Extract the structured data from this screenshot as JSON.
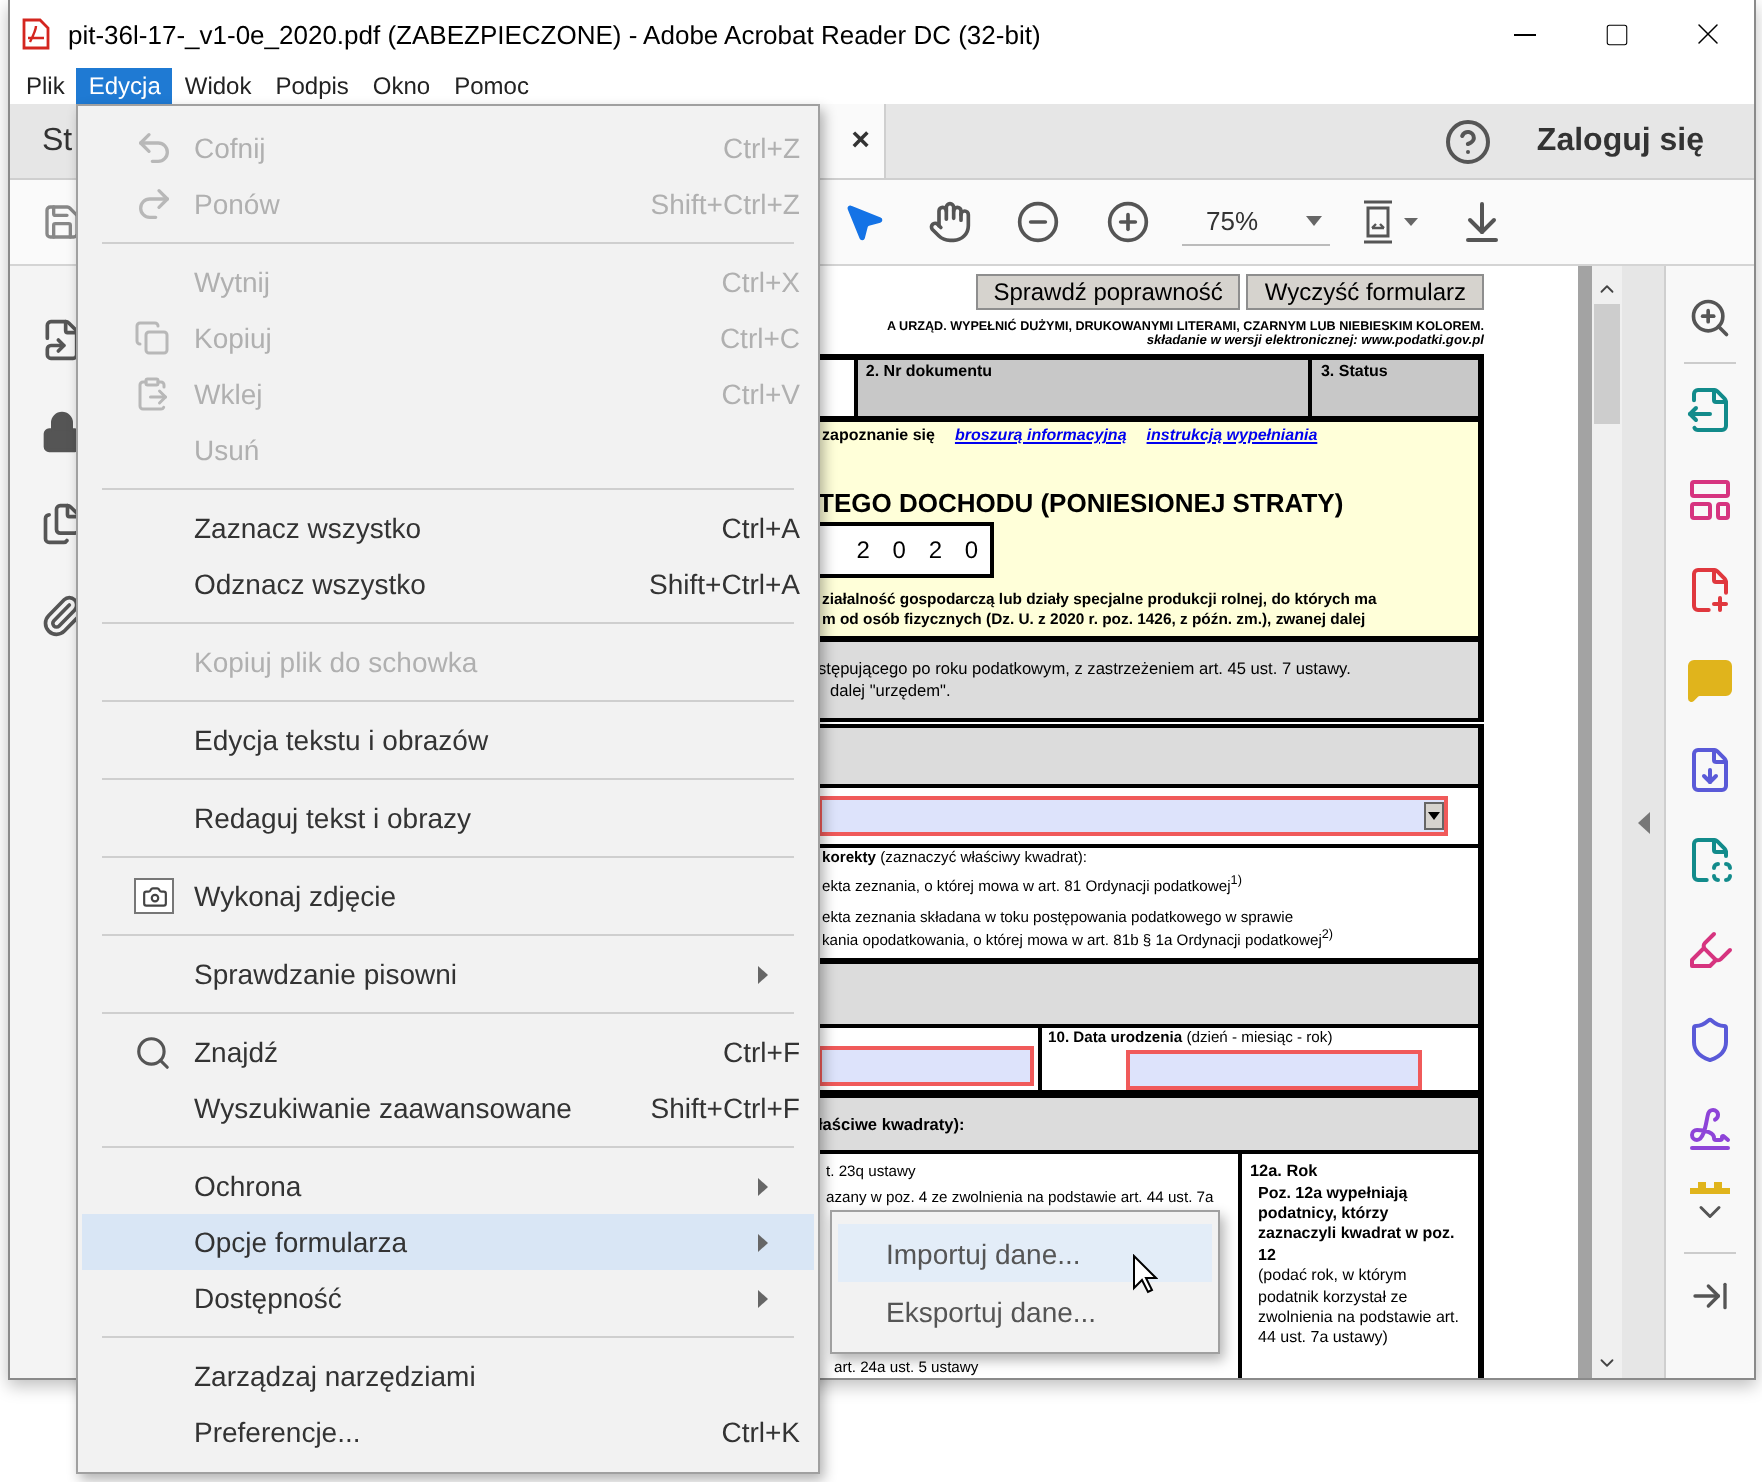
{
  "window": {
    "title": "pit-36l-17-_v1-0e_2020.pdf (ZABEZPIECZONE) - Adobe Acrobat Reader DC (32-bit)"
  },
  "menu_bar": [
    {
      "label": "Plik",
      "selected": false
    },
    {
      "label": "Edycja",
      "selected": true
    },
    {
      "label": "Widok",
      "selected": false
    },
    {
      "label": "Podpis",
      "selected": false
    },
    {
      "label": "Okno",
      "selected": false
    },
    {
      "label": "Pomoc",
      "selected": false
    }
  ],
  "tabs": [
    {
      "label": "St",
      "selected": false
    },
    {
      "close": "×",
      "selected": true
    }
  ],
  "sign_in": "Zaloguj się",
  "toolbar": {
    "zoom": "75%"
  },
  "form": {
    "buttons": [
      "Sprawdź poprawność",
      "Wyczyść formularz"
    ],
    "notice": "A URZĄD. WYPEŁNIĆ DUŻYMI, DRUKOWANYMI LITERAMI, CZARNYM LUB NIEBIESKIM KOLOREM.",
    "submission_note": "składanie w wersji elektronicznej: www.podatki.gov.pl",
    "header_fields": [
      "2. Nr dokumentu",
      "3. Status"
    ],
    "intro": "zapoznanie się",
    "links": [
      "broszurą informacyjną",
      "instrukcją wypełniania"
    ],
    "title": "TEGO DOCHODU (PONIESIONEJ STRATY)",
    "year": "2 0 2 0",
    "scope_lines": [
      "ziałalność gospodarczą lub działy specjalne produkcji rolnej, do których ma",
      "m od osób fizycznych (Dz. U. z 2020 r. poz. 1426, z późn. zm.), zwanej dalej"
    ],
    "office_lines": [
      "stępującego po roku podatkowym, z zastrzeżeniem art. 45 ust. 7 ustawy.",
      "dalej \"urzędem\"."
    ],
    "correction_lines": [
      "**korekty** (zaznaczyć właściwy kwadrat):",
      "ekta zeznania, o której mowa w art. 81 Ordynacji podatkowej$^{1)}$",
      "ekta zeznania składana w toku postępowania podatkowego w sprawie",
      "kania opodatkowania, o której mowa w art. 81b § 1a Ordynacji podatkowej$^{2)}$"
    ],
    "birth_date_label": "**10. Data urodzenia** (dzień - miesiąc - rok)",
    "section_label": "łaściwe kwadraty):",
    "left_lines": [
      "t. 23q ustawy",
      "azany w poz. 4 ze zwolnienia na podstawie art. 44 ust. 7a",
      "art. 24a ust. 5 ustawy"
    ],
    "year_field": {
      "label": "12a. Rok",
      "note": "Poz. 12a wypełniają podatnicy, którzy zaznaczyli kwadrat w poz. 12",
      "hint": "(podać rok, w którym podatnik korzystał ze zwolnienia na podstawie art. 44 ust. 7a ustawy)"
    }
  },
  "edit_menu": {
    "groups": [
      [
        {
          "label": "Cofnij",
          "shortcut": "Ctrl+Z",
          "kind": "undo",
          "disabled": true,
          "selected": false,
          "has_submenu": false
        },
        {
          "label": "Ponów",
          "shortcut": "Shift+Ctrl+Z",
          "kind": "redo",
          "disabled": true,
          "selected": false,
          "has_submenu": false
        }
      ],
      [
        {
          "label": "Wytnij",
          "shortcut": "Ctrl+X",
          "kind": "plain",
          "disabled": true,
          "selected": false,
          "has_submenu": false
        },
        {
          "label": "Kopiuj",
          "shortcut": "Ctrl+C",
          "kind": "copy",
          "disabled": true,
          "selected": false,
          "has_submenu": false
        },
        {
          "label": "Wklej",
          "shortcut": "Ctrl+V",
          "kind": "paste",
          "disabled": true,
          "selected": false,
          "has_submenu": false
        },
        {
          "label": "Usuń",
          "kind": "plain",
          "disabled": true,
          "selected": false,
          "has_submenu": false
        }
      ],
      [
        {
          "label": "Zaznacz wszystko",
          "shortcut": "Ctrl+A",
          "kind": "plain",
          "disabled": false,
          "selected": false,
          "has_submenu": false
        },
        {
          "label": "Odznacz wszystko",
          "shortcut": "Shift+Ctrl+A",
          "kind": "plain",
          "disabled": false,
          "selected": false,
          "has_submenu": false
        }
      ],
      [
        {
          "label": "Kopiuj plik do schowka",
          "kind": "plain",
          "disabled": true,
          "selected": false,
          "has_submenu": false
        }
      ],
      [
        {
          "label": "Edycja tekstu i obrazów",
          "kind": "plain",
          "disabled": false,
          "selected": false,
          "has_submenu": false
        }
      ],
      [
        {
          "label": "Redaguj tekst i obrazy",
          "kind": "plain",
          "disabled": false,
          "selected": false,
          "has_submenu": false
        }
      ],
      [
        {
          "label": "Wykonaj zdjęcie",
          "kind": "camera",
          "disabled": false,
          "selected": false,
          "has_submenu": false
        }
      ],
      [
        {
          "label": "Sprawdzanie pisowni",
          "kind": "plain",
          "disabled": false,
          "selected": false,
          "has_submenu": true
        }
      ],
      [
        {
          "label": "Znajdź",
          "shortcut": "Ctrl+F",
          "kind": "search",
          "disabled": false,
          "selected": false,
          "has_submenu": false
        },
        {
          "label": "Wyszukiwanie zaawansowane",
          "shortcut": "Shift+Ctrl+F",
          "kind": "plain",
          "disabled": false,
          "selected": false,
          "has_submenu": false
        }
      ],
      [
        {
          "label": "Ochrona",
          "kind": "plain",
          "disabled": false,
          "selected": false,
          "has_submenu": true
        },
        {
          "label": "Opcje formularza",
          "kind": "plain",
          "disabled": false,
          "selected": true,
          "has_submenu": true
        },
        {
          "label": "Dostępność",
          "kind": "plain",
          "disabled": false,
          "selected": false,
          "has_submenu": true
        }
      ],
      [
        {
          "label": "Zarządzaj narzędziami",
          "kind": "plain",
          "disabled": false,
          "selected": false,
          "has_submenu": false
        },
        {
          "label": "Preferencje...",
          "shortcut": "Ctrl+K",
          "kind": "plain",
          "disabled": false,
          "selected": false,
          "has_submenu": false
        }
      ]
    ]
  },
  "form_submenu": {
    "items": [
      {
        "label": "Importuj dane...",
        "selected": true
      },
      {
        "label": "Eksportuj dane...",
        "selected": false
      }
    ]
  }
}
